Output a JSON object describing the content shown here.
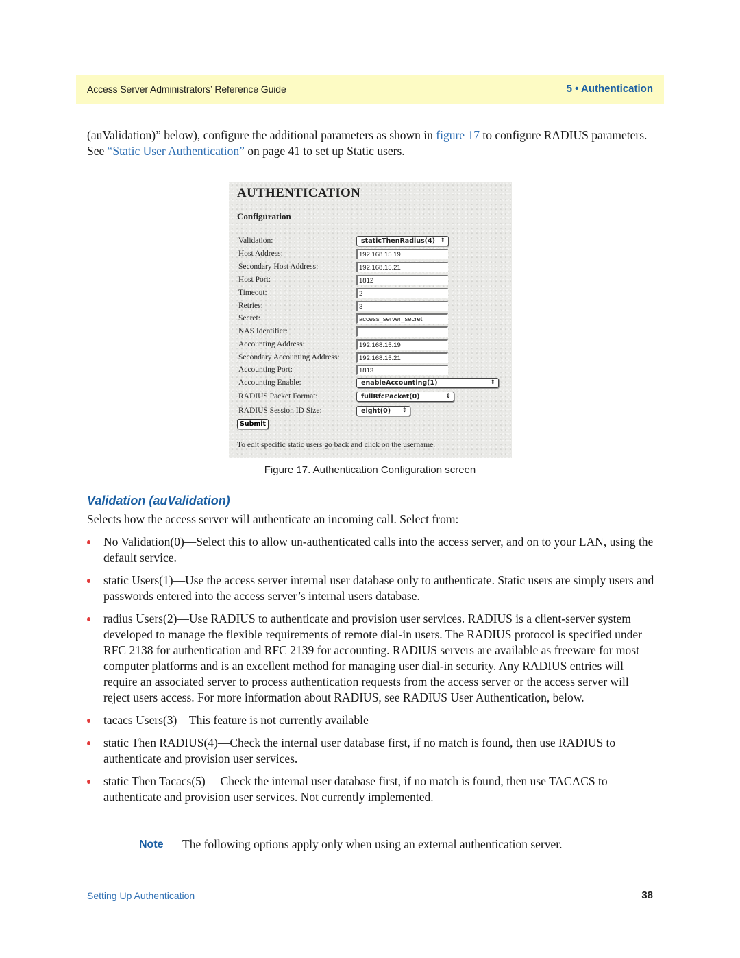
{
  "header": {
    "guide_title": "Access Server Administrators’ Reference Guide",
    "chapter": "5 • Authentication"
  },
  "intro": {
    "part1": "(auValidation)” below), configure the additional parameters as shown in ",
    "figure_link": "figure 17",
    "part2": " to configure RADIUS parameters. See ",
    "section_link": "“Static User Authentication”",
    "part3": " on page 41 to set up Static users."
  },
  "figure": {
    "title": "AUTHENTICATION",
    "subtitle": "Configuration",
    "fields": [
      {
        "label": "Validation:",
        "type": "select",
        "value": "staticThenRadius(4)"
      },
      {
        "label": "Host Address:",
        "type": "text",
        "value": "192.168.15.19"
      },
      {
        "label": "Secondary Host Address:",
        "type": "text",
        "value": "192.168.15.21"
      },
      {
        "label": "Host Port:",
        "type": "text",
        "value": "1812"
      },
      {
        "label": "Timeout:",
        "type": "text",
        "value": "2"
      },
      {
        "label": "Retries:",
        "type": "text",
        "value": "3"
      },
      {
        "label": "Secret:",
        "type": "text",
        "value": "access_server_secret"
      },
      {
        "label": "NAS Identifier:",
        "type": "text",
        "value": ""
      },
      {
        "label": "Accounting Address:",
        "type": "text",
        "value": "192.168.15.19"
      },
      {
        "label": "Secondary Accounting Address:",
        "type": "text",
        "value": "192.168.15.21"
      },
      {
        "label": "Accounting Port:",
        "type": "text",
        "value": "1813"
      },
      {
        "label": "Accounting Enable:",
        "type": "select",
        "value": "enableAccounting(1)"
      },
      {
        "label": "RADIUS Packet Format:",
        "type": "select",
        "value": "fullRfcPacket(0)"
      },
      {
        "label": "RADIUS Session ID Size:",
        "type": "select",
        "value": "eight(0)"
      }
    ],
    "submit_label": "Submit",
    "note": "To edit specific static users go back and click on the username.",
    "select_arrows": "⇕"
  },
  "caption": "Figure 17. Authentication Configuration screen",
  "section": {
    "heading": "Validation (auValidation)",
    "lead": "Selects how the access server will authenticate an incoming call. Select from:",
    "bullets": [
      "No Validation(0)—Select this to allow un-authenticated calls into the access server, and on to your LAN, using the default service.",
      "static Users(1)—Use the access server internal user database only to authenticate. Static users are simply users and passwords entered into the access server’s internal users database.",
      "radius Users(2)—Use RADIUS to authenticate and provision user services. RADIUS is a client-server sys­tem developed to manage the flexible requirements of remote dial-in users. The RADIUS protocol is speci­fied under RFC 2138 for authentication and RFC 2139 for accounting. RADIUS servers are available as freeware for most computer platforms and is an excellent method for managing user dial-in security. Any RADIUS entries will require an associated server to process authentication requests from the access server or the access server will reject users access. For more information about RADIUS, see RADIUS User Authen­tication, below.",
      "tacacs Users(3)—This feature is not currently available",
      "static Then RADIUS(4)—Check the internal user database first, if no match is found, then use RADIUS to authenticate and provision user services.",
      "static Then Tacacs(5)— Check the internal user database first, if no match is found, then use TACACS to authenticate and provision user services. Not currently implemented."
    ]
  },
  "note": {
    "label": "Note",
    "text": "The following options apply only when using an external authentication server."
  },
  "footer": {
    "section": "Setting Up Authentication",
    "page": "38"
  }
}
